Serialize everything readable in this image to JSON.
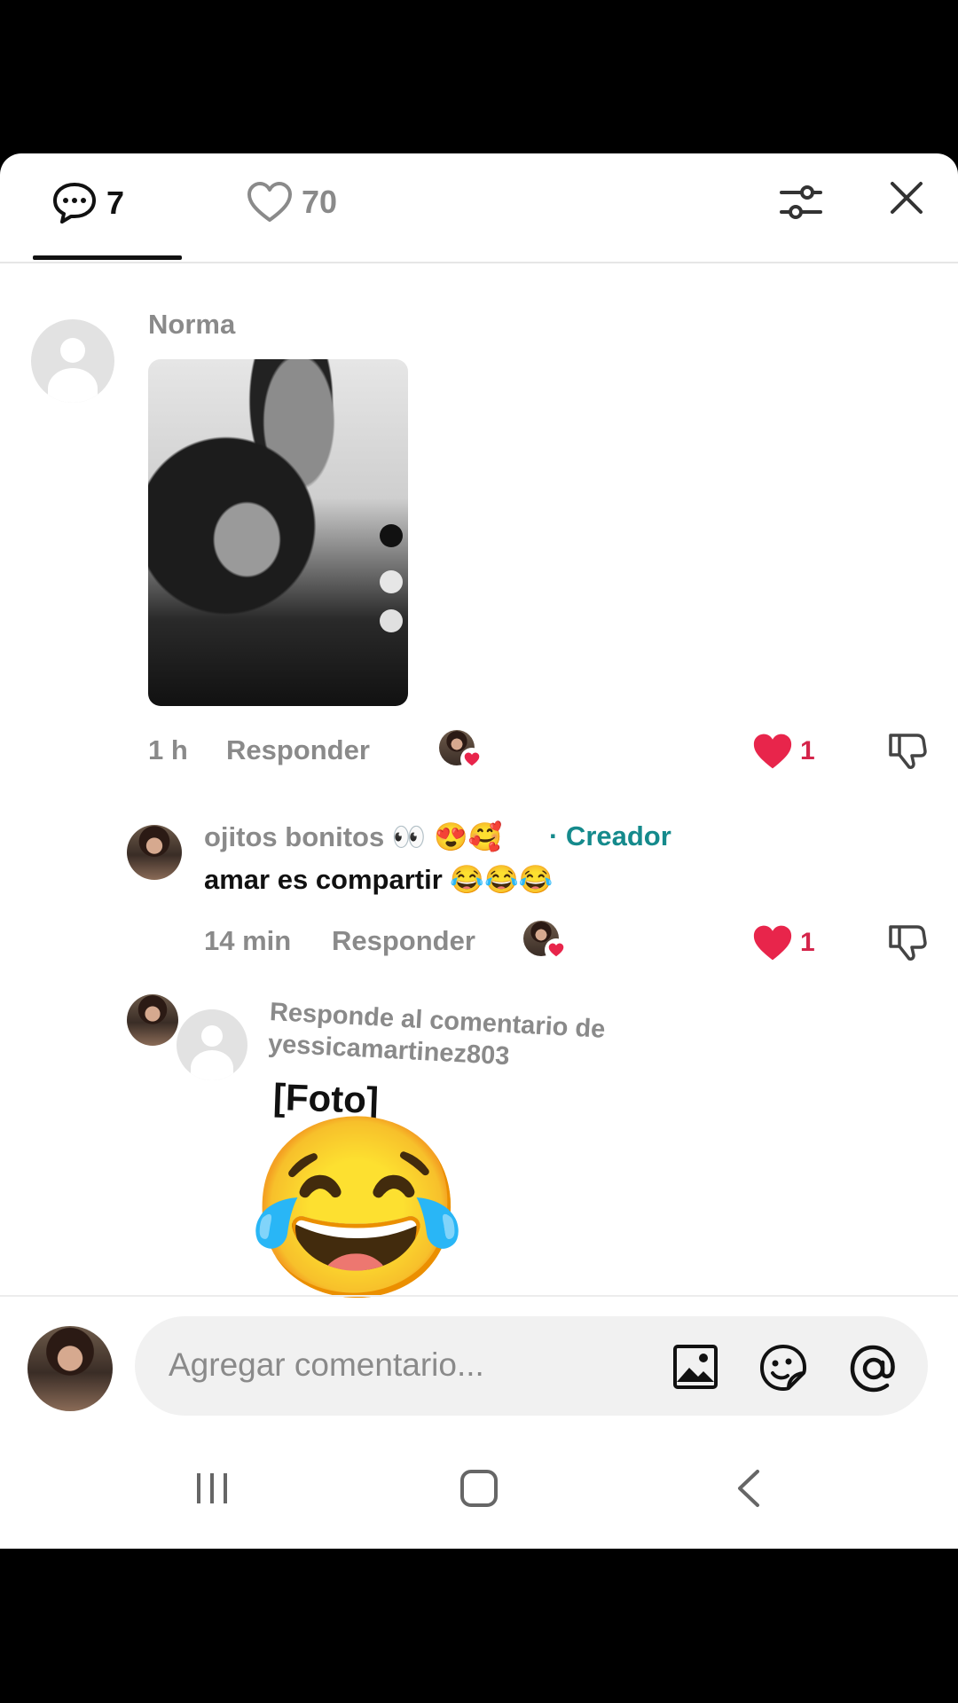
{
  "header": {
    "comments_count": "7",
    "likes_count": "70"
  },
  "comments": [
    {
      "username": "Norma",
      "time": "1 h",
      "reply_label": "Responder",
      "likes": "1"
    },
    {
      "username": "ojitos bonitos 👀 😍🥰",
      "creator_badge": "· Creador",
      "text": "amar es compartir 😂😂😂",
      "time": "14 min",
      "reply_label": "Responder",
      "likes": "1"
    }
  ],
  "reply_card": {
    "title": "Responde al comentario de yessicamartinez803",
    "body": "[Foto]",
    "emoji": "😂"
  },
  "input": {
    "placeholder": "Agregar comentario..."
  },
  "colors": {
    "accent_like": "#e8254b",
    "creator": "#158a8c",
    "muted": "#8a8a8a"
  },
  "icons": [
    "comment-icon",
    "heart-icon",
    "filter-icon",
    "close-icon",
    "dislike-icon",
    "image-icon",
    "sticker-icon",
    "mention-icon",
    "recents-icon",
    "home-icon",
    "back-icon"
  ]
}
